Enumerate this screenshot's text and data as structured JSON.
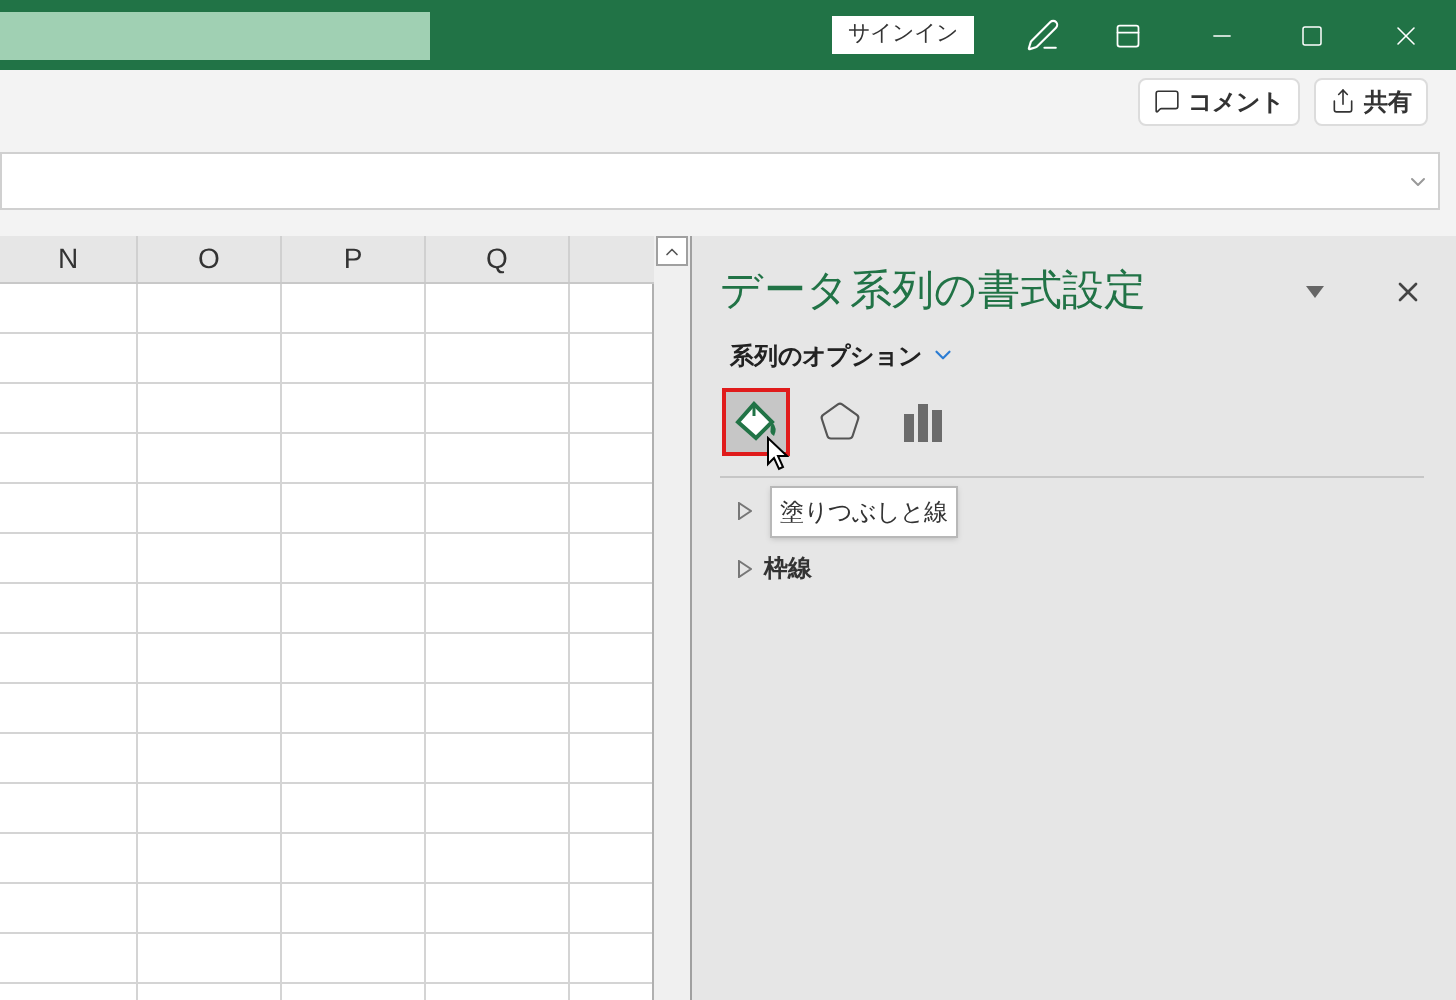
{
  "title_bar": {
    "sign_in": "サインイン"
  },
  "toolbar": {
    "buttons": [
      {
        "kind": "comment",
        "label": "コメント"
      },
      {
        "kind": "share",
        "label": "共有"
      }
    ]
  },
  "grid": {
    "columns": [
      "N",
      "O",
      "P",
      "Q"
    ]
  },
  "panel": {
    "title": "データ系列の書式設定",
    "options_label": "系列のオプション",
    "tabs": [
      {
        "kind": "fill",
        "selected": true
      },
      {
        "kind": "effects",
        "selected": false
      },
      {
        "kind": "series",
        "selected": false
      }
    ],
    "tooltip": "塗りつぶしと線",
    "sections": [
      {
        "expanded": false
      },
      {
        "label": "枠線",
        "expanded": false
      }
    ]
  }
}
